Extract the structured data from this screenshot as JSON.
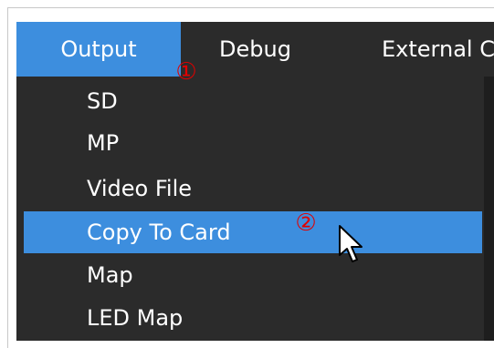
{
  "menubar": {
    "items": [
      {
        "label": "Output",
        "active": true
      },
      {
        "label": "Debug",
        "active": false
      },
      {
        "label": "External C",
        "active": false
      }
    ]
  },
  "dropdown": {
    "items": [
      {
        "label": "SD",
        "highlighted": false
      },
      {
        "label": "MP",
        "highlighted": false
      },
      {
        "label": "Video File",
        "highlighted": false
      },
      {
        "label": "Copy To Card",
        "highlighted": true
      },
      {
        "label": "Map",
        "highlighted": false
      },
      {
        "label": "LED Map",
        "highlighted": false
      }
    ]
  },
  "annotations": {
    "step1": "①",
    "step2": "②"
  },
  "colors": {
    "menu_background": "#2b2b2b",
    "highlight": "#3d8ede",
    "marker": "#e00000",
    "text": "#ffffff"
  },
  "icons": {
    "cursor": "mouse-pointer-icon"
  }
}
